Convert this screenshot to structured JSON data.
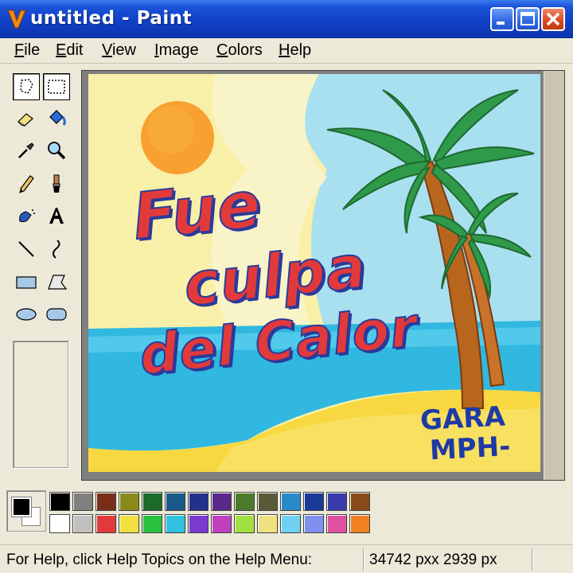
{
  "window": {
    "title": "untitled - Paint"
  },
  "menu": [
    {
      "key": "F",
      "rest": "ile"
    },
    {
      "key": "E",
      "rest": "dit"
    },
    {
      "key": "V",
      "rest": "iew"
    },
    {
      "key": "I",
      "rest": "mage"
    },
    {
      "key": "C",
      "rest": "olors"
    },
    {
      "key": "H",
      "rest": "elp"
    }
  ],
  "tools": [
    "free-form-select-icon",
    "select-icon",
    "eraser-icon",
    "fill-bucket-icon",
    "pick-color-icon",
    "magnifier-icon",
    "pencil-icon",
    "brush-icon",
    "airbrush-icon",
    "text-icon",
    "line-icon",
    "curve-icon",
    "rectangle-icon",
    "polygon-icon",
    "ellipse-icon",
    "rounded-rectangle-icon"
  ],
  "canvas": {
    "slogan_lines": [
      "Fue",
      "culpa",
      "del Calor"
    ],
    "signature_lines": [
      "GARA",
      "MPH-"
    ]
  },
  "palette": {
    "foreground": "#000000",
    "background": "#ffffff",
    "row1": [
      "#000000",
      "#808080",
      "#7a2e1a",
      "#8a8a1a",
      "#1c6b2a",
      "#1a5a8a",
      "#24318c",
      "#5a2a8a",
      "#4a7a2a",
      "#5a5a3a",
      "#2a8ac8",
      "#1a3a9a",
      "#3a3aaa",
      "#8a4a1a"
    ],
    "row2": [
      "#ffffff",
      "#c0c0c0",
      "#e23a3a",
      "#f0e040",
      "#2ac040",
      "#30c0e0",
      "#7a3ad0",
      "#c040c0",
      "#a0e040",
      "#f0e080",
      "#70d0f0",
      "#8090f0",
      "#e050a0",
      "#f08020"
    ]
  },
  "status": {
    "help_text": "For Help, click Help Topics on the Help Menu:",
    "coords": "34742 pxx 2939 px"
  }
}
